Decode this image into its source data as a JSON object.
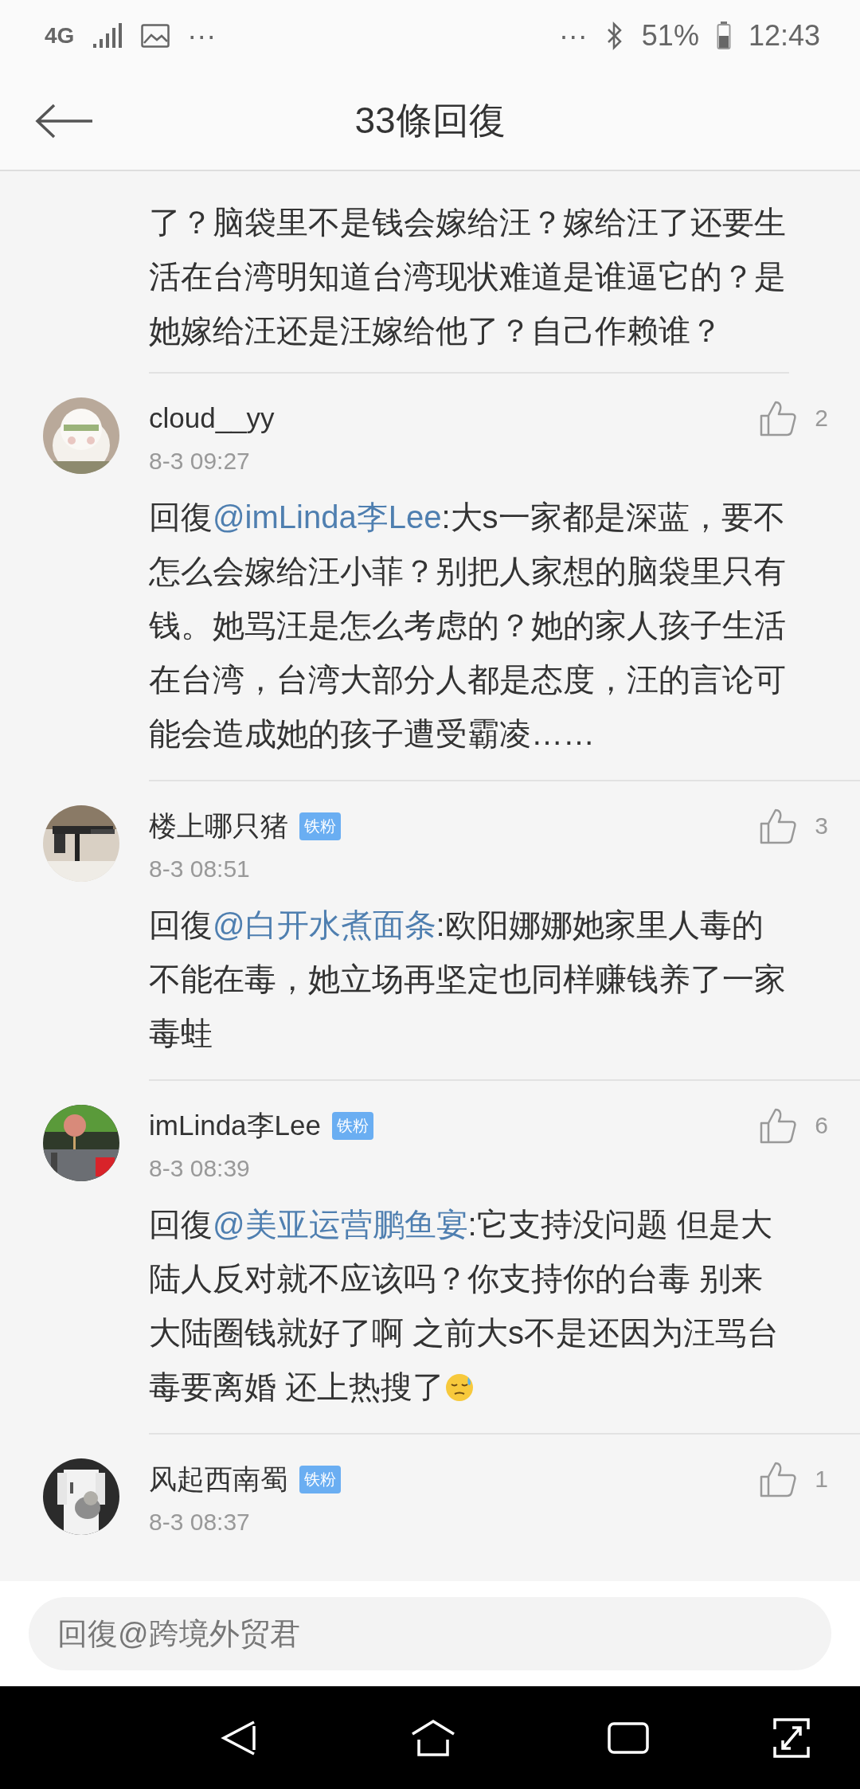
{
  "status_bar": {
    "network": "4G",
    "left_more": "···",
    "right_more": "···",
    "battery": "51%",
    "time": "12:43"
  },
  "header": {
    "title": "33條回復"
  },
  "partial_comment": {
    "text": "了？脑袋里不是钱会嫁给汪？嫁给汪了还要生活在台湾明知道台湾现状难道是谁逼它的？是她嫁给汪还是汪嫁给他了？自己作赖谁？"
  },
  "comments": [
    {
      "user": "cloud__yy",
      "likes": "2",
      "time": "8-3 09:27",
      "reply_prefix": "回復",
      "reply_to": "@imLinda李Lee",
      "text": ":大s一家都是深蓝，要不怎么会嫁给汪小菲？别把人家想的脑袋里只有钱。她骂汪是怎么考虑的？她的家人孩子生活在台湾，台湾大部分人都是态度，汪的言论可能会造成她的孩子遭受霸凌……"
    },
    {
      "user": "楼上哪只猪",
      "badge": "铁粉",
      "likes": "3",
      "time": "8-3 08:51",
      "reply_prefix": "回復",
      "reply_to": "@白开水煮面条",
      "text": ":欧阳娜娜她家里人毒的不能在毒，她立场再坚定也同样赚钱养了一家毒蛙"
    },
    {
      "user": "imLinda李Lee",
      "badge": "铁粉",
      "likes": "6",
      "time": "8-3 08:39",
      "reply_prefix": "回復",
      "reply_to": "@美亚运营鹏鱼宴",
      "text": ":它支持没问题 但是大陆人反对就不应该吗？你支持你的台毒 别来大陆圈钱就好了啊 之前大s不是还因为汪骂台毒要离婚 还上热搜了",
      "sweat_emoji": true
    },
    {
      "user": "风起西南蜀",
      "badge": "铁粉",
      "likes": "1",
      "time": "8-3 08:37"
    }
  ],
  "reply_field": {
    "placeholder": "回復@跨境外贸君"
  }
}
